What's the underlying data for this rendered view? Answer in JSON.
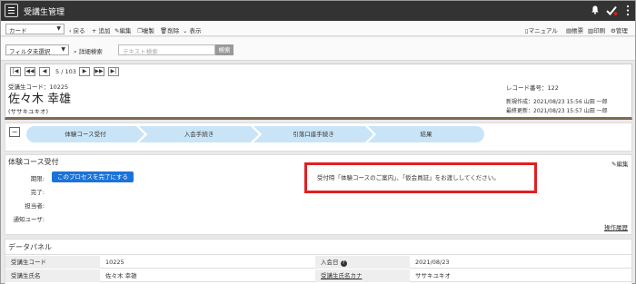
{
  "app": {
    "title": "受講生管理"
  },
  "toolbar": {
    "view_select": "カード",
    "back": "戻る",
    "add": "追加",
    "edit": "編集",
    "copy": "複製",
    "delete": "削除",
    "display": "表示",
    "manual": "マニュアル",
    "form": "帳票",
    "print": "印刷",
    "admin": "管理"
  },
  "filter": {
    "select": "フィルタ未選択",
    "advanced_search": "詳細検索",
    "search_placeholder": "テキスト検索",
    "search_button": "検索"
  },
  "pager": {
    "position": "5 / 103"
  },
  "record": {
    "code_label": "受講生コード：10225",
    "name": "佐々木 幸雄",
    "kana": "(ササキユキオ)",
    "record_no": "レコード番号：122",
    "created": "新規作成：2021/08/23 15:56 山田 一郎",
    "updated": "最終更新：2021/08/23 15:57 山田 一郎"
  },
  "process": {
    "toggle": "−",
    "steps": [
      "体験コース受付",
      "入会手続き",
      "引落口座手続き",
      "結果"
    ]
  },
  "step_detail": {
    "title": "体験コース受付",
    "edit": "編集",
    "deadline_label": "期限:",
    "complete_button": "このプロセスを完了にする",
    "done_label": "完了:",
    "assignee_label": "担当者:",
    "notify_label": "通知ユーザ:",
    "message": "受付時「体験コースのご案内」、「仮会員証」をお渡ししてください。",
    "history_link": "操作履歴"
  },
  "data_panel": {
    "title": "データパネル",
    "rows": [
      {
        "l1": "受講生コード",
        "v1": "10225",
        "l2": "入会日",
        "v2": "2021/08/23"
      },
      {
        "l1": "受講生氏名",
        "v1": "佐々木 幸雄",
        "l2": "受講生氏名カナ",
        "v2": "ササキユキオ"
      }
    ]
  },
  "colors": {
    "topbar": "#333333",
    "accent_blue": "#1a73d9",
    "highlight_red": "#e02020",
    "process_step": "#c9e4f7"
  }
}
